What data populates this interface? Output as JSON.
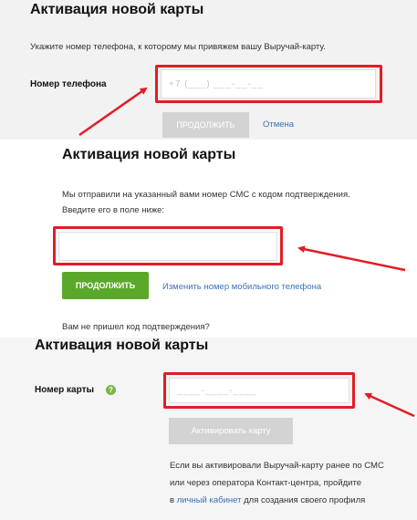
{
  "step1": {
    "title": "Активация новой карты",
    "description": "Укажите номер телефона, к которому мы привяжем вашу Выручай-карту.",
    "phone_label": "Номер телефона",
    "phone_mask": "+7 (___) ___-__-__",
    "continue_label": "ПРОДОЛЖИТЬ",
    "cancel_label": "Отмена"
  },
  "step2": {
    "title": "Активация новой карты",
    "description_line1": "Мы отправили на указанный вами номер СМС с кодом подтверждения.",
    "description_line2": "Введите его в поле ниже:",
    "continue_label": "ПРОДОЛЖИТЬ",
    "change_phone_link": "Изменить номер мобильного телефона",
    "no_code_text": "Вам не пришел код подтверждения?"
  },
  "step3": {
    "title": "Активация новой карты",
    "card_label": "Номер карты",
    "help_glyph": "?",
    "card_mask": "____-____-____",
    "activate_label": "Активировать карту",
    "info_line1": "Если вы активировали Выручай-карту ранее по СМС",
    "info_line2": "или через оператора Контакт-центра, пройдите",
    "info_line3_prefix": "в",
    "info_link": "личный кабинет",
    "info_line3_suffix": "для создания своего профиля"
  },
  "colors": {
    "highlight": "#e11d25",
    "green_button": "#5aa82a",
    "link": "#3a72b8"
  }
}
